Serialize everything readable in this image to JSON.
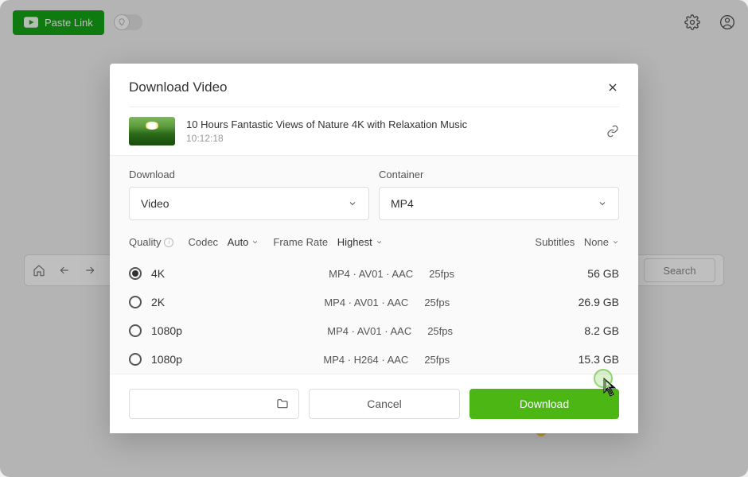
{
  "topbar": {
    "paste_label": "Paste Link"
  },
  "browser": {
    "search_placeholder": "Search"
  },
  "modal": {
    "title": "Download Video",
    "video_title": "10 Hours Fantastic Views of Nature 4K with Relaxation Music",
    "video_duration": "10:12:18",
    "download_label": "Download",
    "download_value": "Video",
    "container_label": "Container",
    "container_value": "MP4",
    "quality_label": "Quality",
    "codec_label": "Codec",
    "codec_value": "Auto",
    "framerate_label": "Frame Rate",
    "framerate_value": "Highest",
    "subtitles_label": "Subtitles",
    "subtitles_value": "None",
    "options": [
      {
        "res": "4K",
        "codec": "MP4 · AV01 · AAC",
        "fps": "25fps",
        "size": "56 GB",
        "selected": true
      },
      {
        "res": "2K",
        "codec": "MP4 · AV01 · AAC",
        "fps": "25fps",
        "size": "26.9 GB",
        "selected": false
      },
      {
        "res": "1080p",
        "codec": "MP4 · AV01 · AAC",
        "fps": "25fps",
        "size": "8.2 GB",
        "selected": false
      },
      {
        "res": "1080p",
        "codec": "MP4 · H264 · AAC",
        "fps": "25fps",
        "size": "15.3 GB",
        "selected": false
      }
    ],
    "cancel_label": "Cancel",
    "download_btn_label": "Download"
  },
  "site_icons": [
    {
      "color": "linear-gradient(135deg,#f09 0%,#f90 50%,#90f 100%)"
    },
    {
      "color": "#000"
    },
    {
      "color": "#4a90e2"
    },
    {
      "color": "#6abce0"
    },
    {
      "color": "#e06aa3"
    },
    {
      "color": "#f0c040"
    }
  ]
}
